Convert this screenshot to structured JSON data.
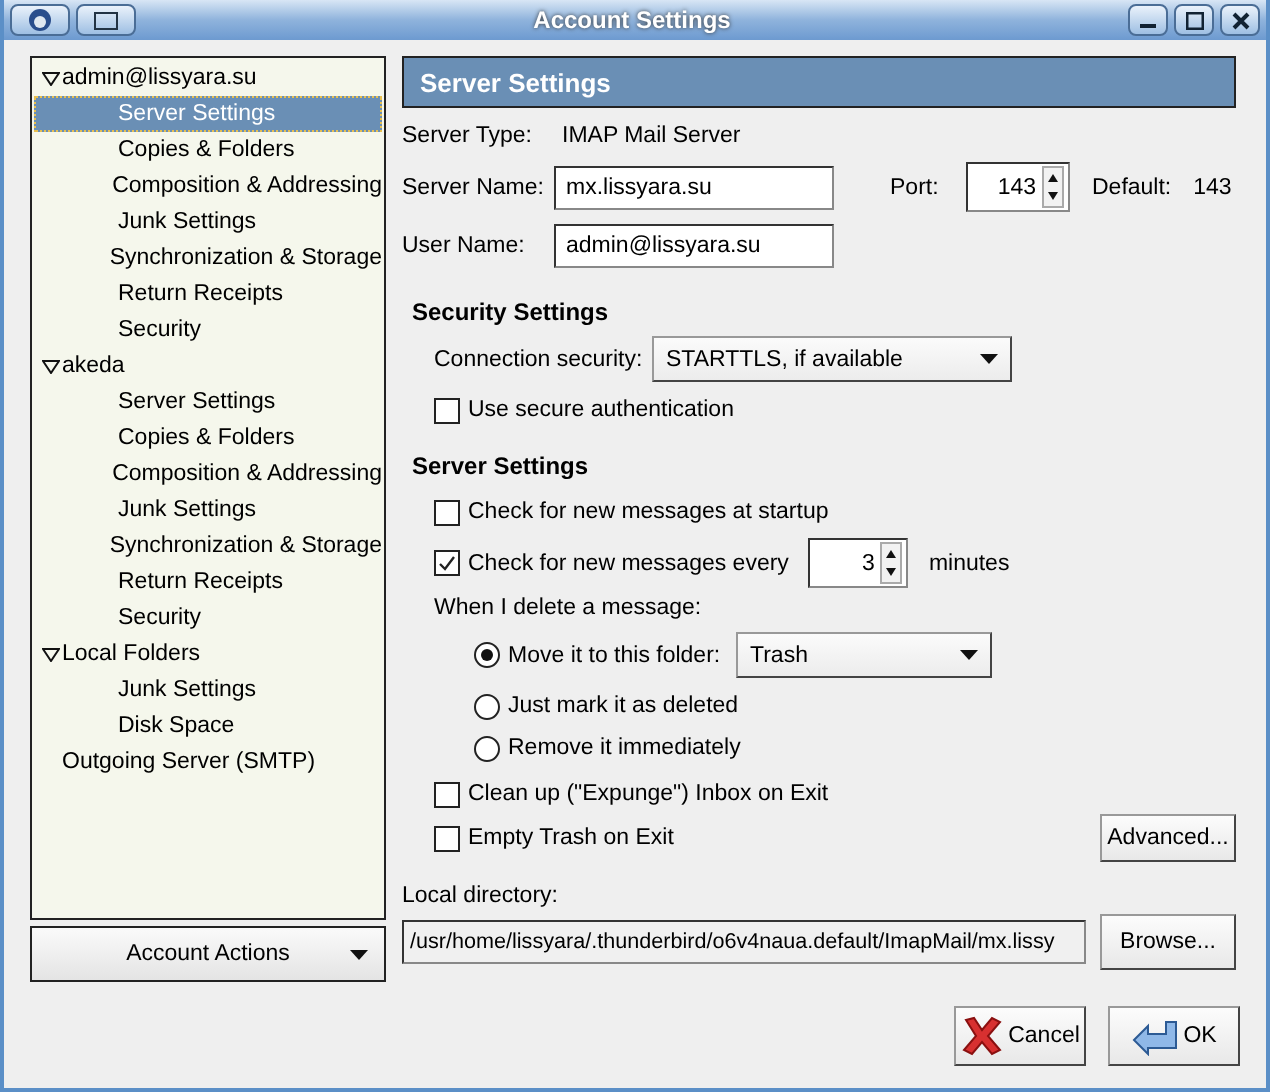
{
  "window": {
    "title": "Account Settings"
  },
  "tree": [
    {
      "label": "admin@lissyara.su",
      "expanded": true,
      "selected": false,
      "children": [
        {
          "label": "Server Settings",
          "selected": true
        },
        {
          "label": "Copies & Folders",
          "selected": false
        },
        {
          "label": "Composition & Addressing",
          "selected": false
        },
        {
          "label": "Junk Settings",
          "selected": false
        },
        {
          "label": "Synchronization & Storage",
          "selected": false
        },
        {
          "label": "Return Receipts",
          "selected": false
        },
        {
          "label": "Security",
          "selected": false
        }
      ]
    },
    {
      "label": "akeda",
      "expanded": true,
      "selected": false,
      "children": [
        {
          "label": "Server Settings",
          "selected": false
        },
        {
          "label": "Copies & Folders",
          "selected": false
        },
        {
          "label": "Composition & Addressing",
          "selected": false
        },
        {
          "label": "Junk Settings",
          "selected": false
        },
        {
          "label": "Synchronization & Storage",
          "selected": false
        },
        {
          "label": "Return Receipts",
          "selected": false
        },
        {
          "label": "Security",
          "selected": false
        }
      ]
    },
    {
      "label": "Local Folders",
      "expanded": true,
      "selected": false,
      "children": [
        {
          "label": "Junk Settings",
          "selected": false
        },
        {
          "label": "Disk Space",
          "selected": false
        }
      ]
    },
    {
      "label": "Outgoing Server (SMTP)",
      "selected": false
    }
  ],
  "account_actions": "Account Actions",
  "panel": {
    "title": "Server Settings",
    "server_type": {
      "label": "Server Type:",
      "value": "IMAP Mail Server"
    },
    "server_name": {
      "label": "Server Name:",
      "value": "mx.lissyara.su"
    },
    "port": {
      "label": "Port:",
      "value": "143"
    },
    "default_port": {
      "label": "Default:",
      "value": "143"
    },
    "user_name": {
      "label": "User Name:",
      "value": "admin@lissyara.su"
    },
    "security": {
      "heading": "Security Settings",
      "connection_label": "Connection security:",
      "connection_value": "STARTTLS, if available",
      "secure_auth": {
        "label": "Use secure authentication",
        "checked": false
      }
    },
    "server": {
      "heading": "Server Settings",
      "check_startup": {
        "label": "Check for new messages at startup",
        "checked": false
      },
      "check_every": {
        "label": "Check for new messages every",
        "checked": true,
        "value": "3",
        "unit": "minutes"
      },
      "delete_label": "When I delete a message:",
      "delete_options": [
        {
          "label": "Move it to this folder:",
          "selected": true,
          "folder": "Trash"
        },
        {
          "label": "Just mark it as deleted",
          "selected": false
        },
        {
          "label": "Remove it immediately",
          "selected": false
        }
      ],
      "cleanup": {
        "label": "Clean up (\"Expunge\") Inbox on Exit",
        "checked": false
      },
      "empty_trash": {
        "label": "Empty Trash on Exit",
        "checked": false
      },
      "advanced": "Advanced..."
    },
    "local_dir": {
      "label": "Local directory:",
      "value": "/usr/home/lissyara/.thunderbird/o6v4naua.default/ImapMail/mx.lissy",
      "browse": "Browse..."
    }
  },
  "buttons": [
    {
      "kind": "cancel",
      "label": "Cancel"
    },
    {
      "kind": "ok",
      "label": "OK"
    }
  ]
}
